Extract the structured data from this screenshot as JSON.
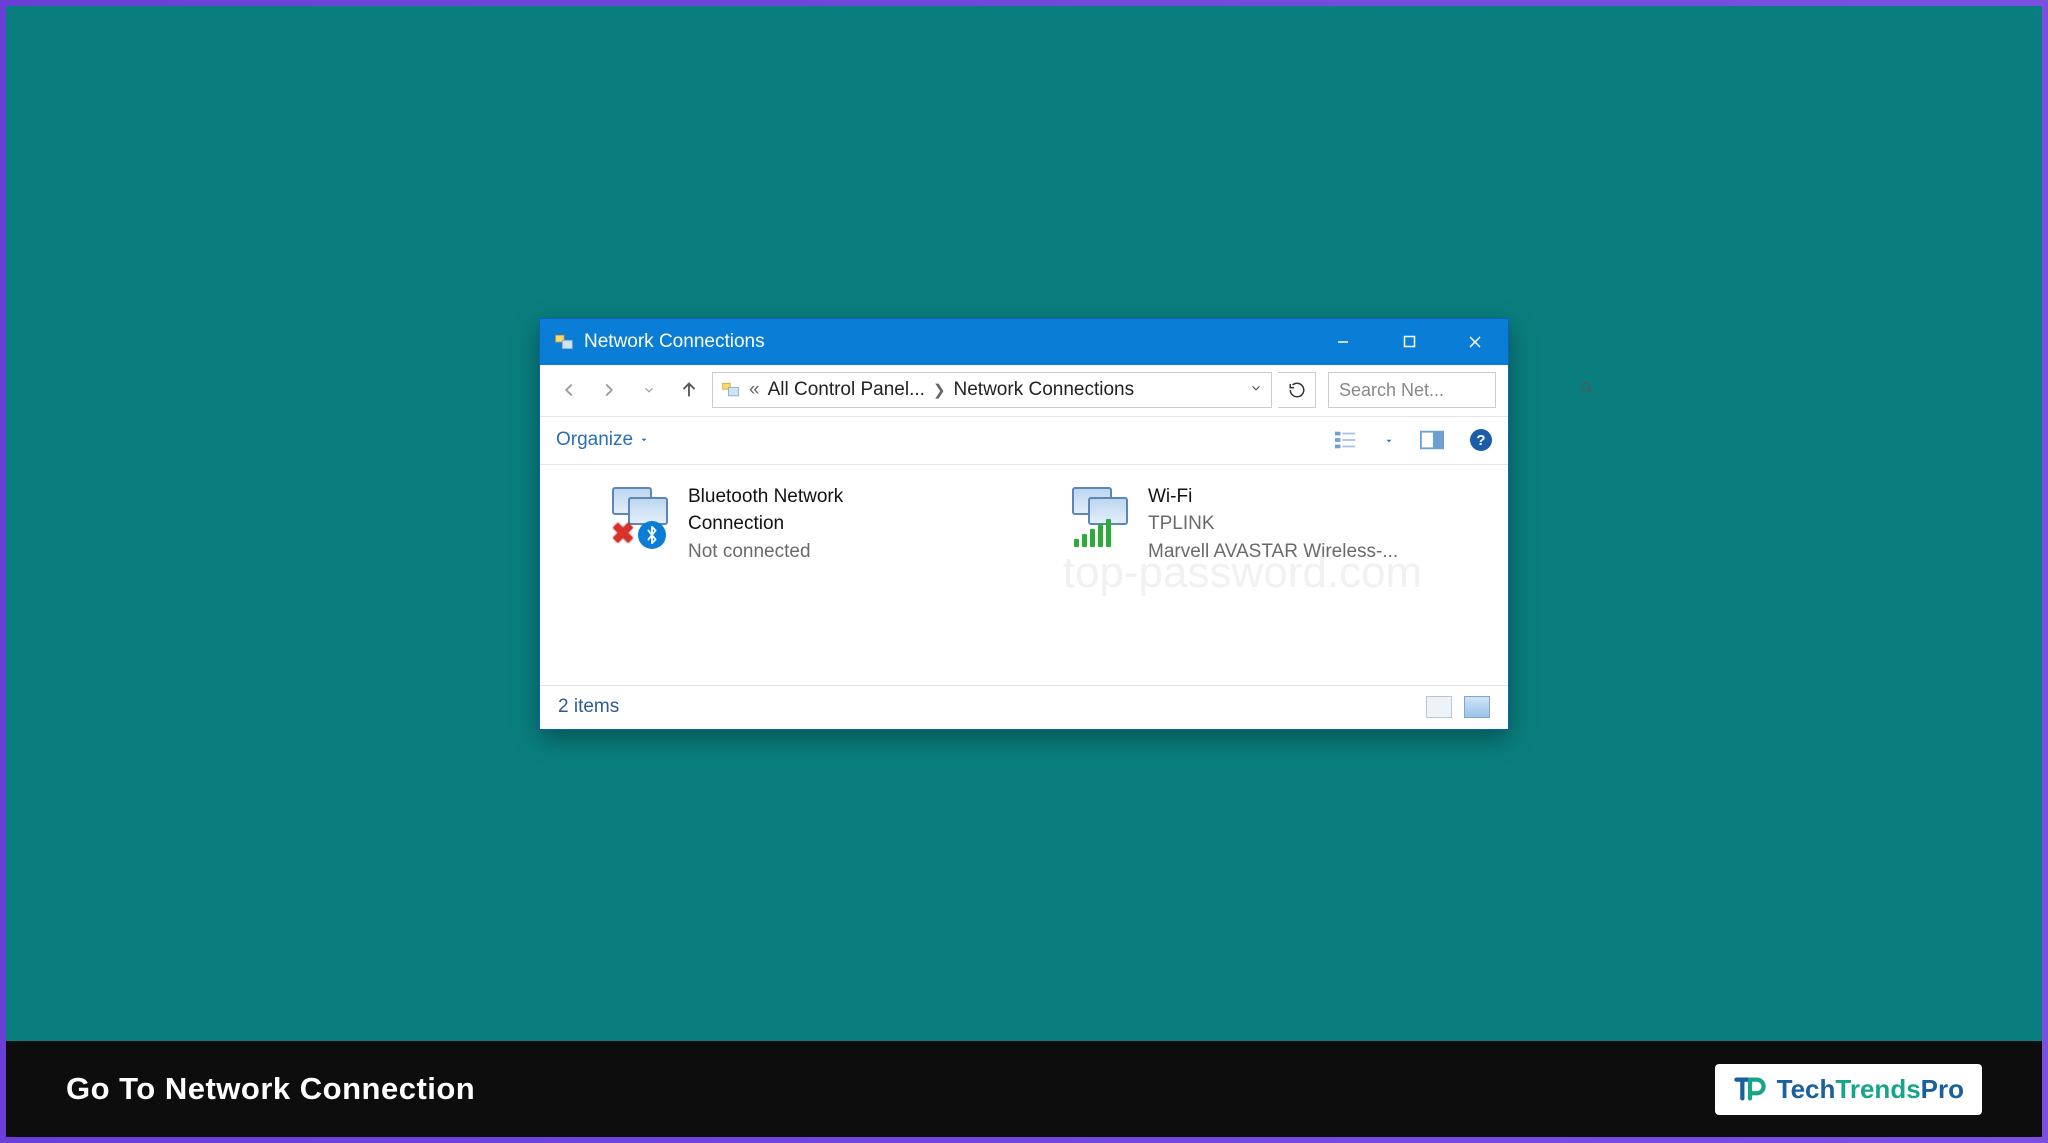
{
  "caption": "Go To Network Connection",
  "brand": {
    "tech": "Tech",
    "trends": "Trends",
    "pro": "Pro"
  },
  "watermark_text": "top-password.com",
  "window": {
    "title": "Network Connections",
    "breadcrumb": {
      "segment1": "All Control Panel...",
      "segment2": "Network Connections"
    },
    "search_placeholder": "Search Net...",
    "organize_label": "Organize",
    "connections": [
      {
        "name_line1": "Bluetooth Network",
        "name_line2": "Connection",
        "status": "Not connected"
      },
      {
        "name_line1": "Wi-Fi",
        "ssid": "TPLINK",
        "adapter": "Marvell AVASTAR Wireless-..."
      }
    ],
    "status_text": "2 items"
  }
}
